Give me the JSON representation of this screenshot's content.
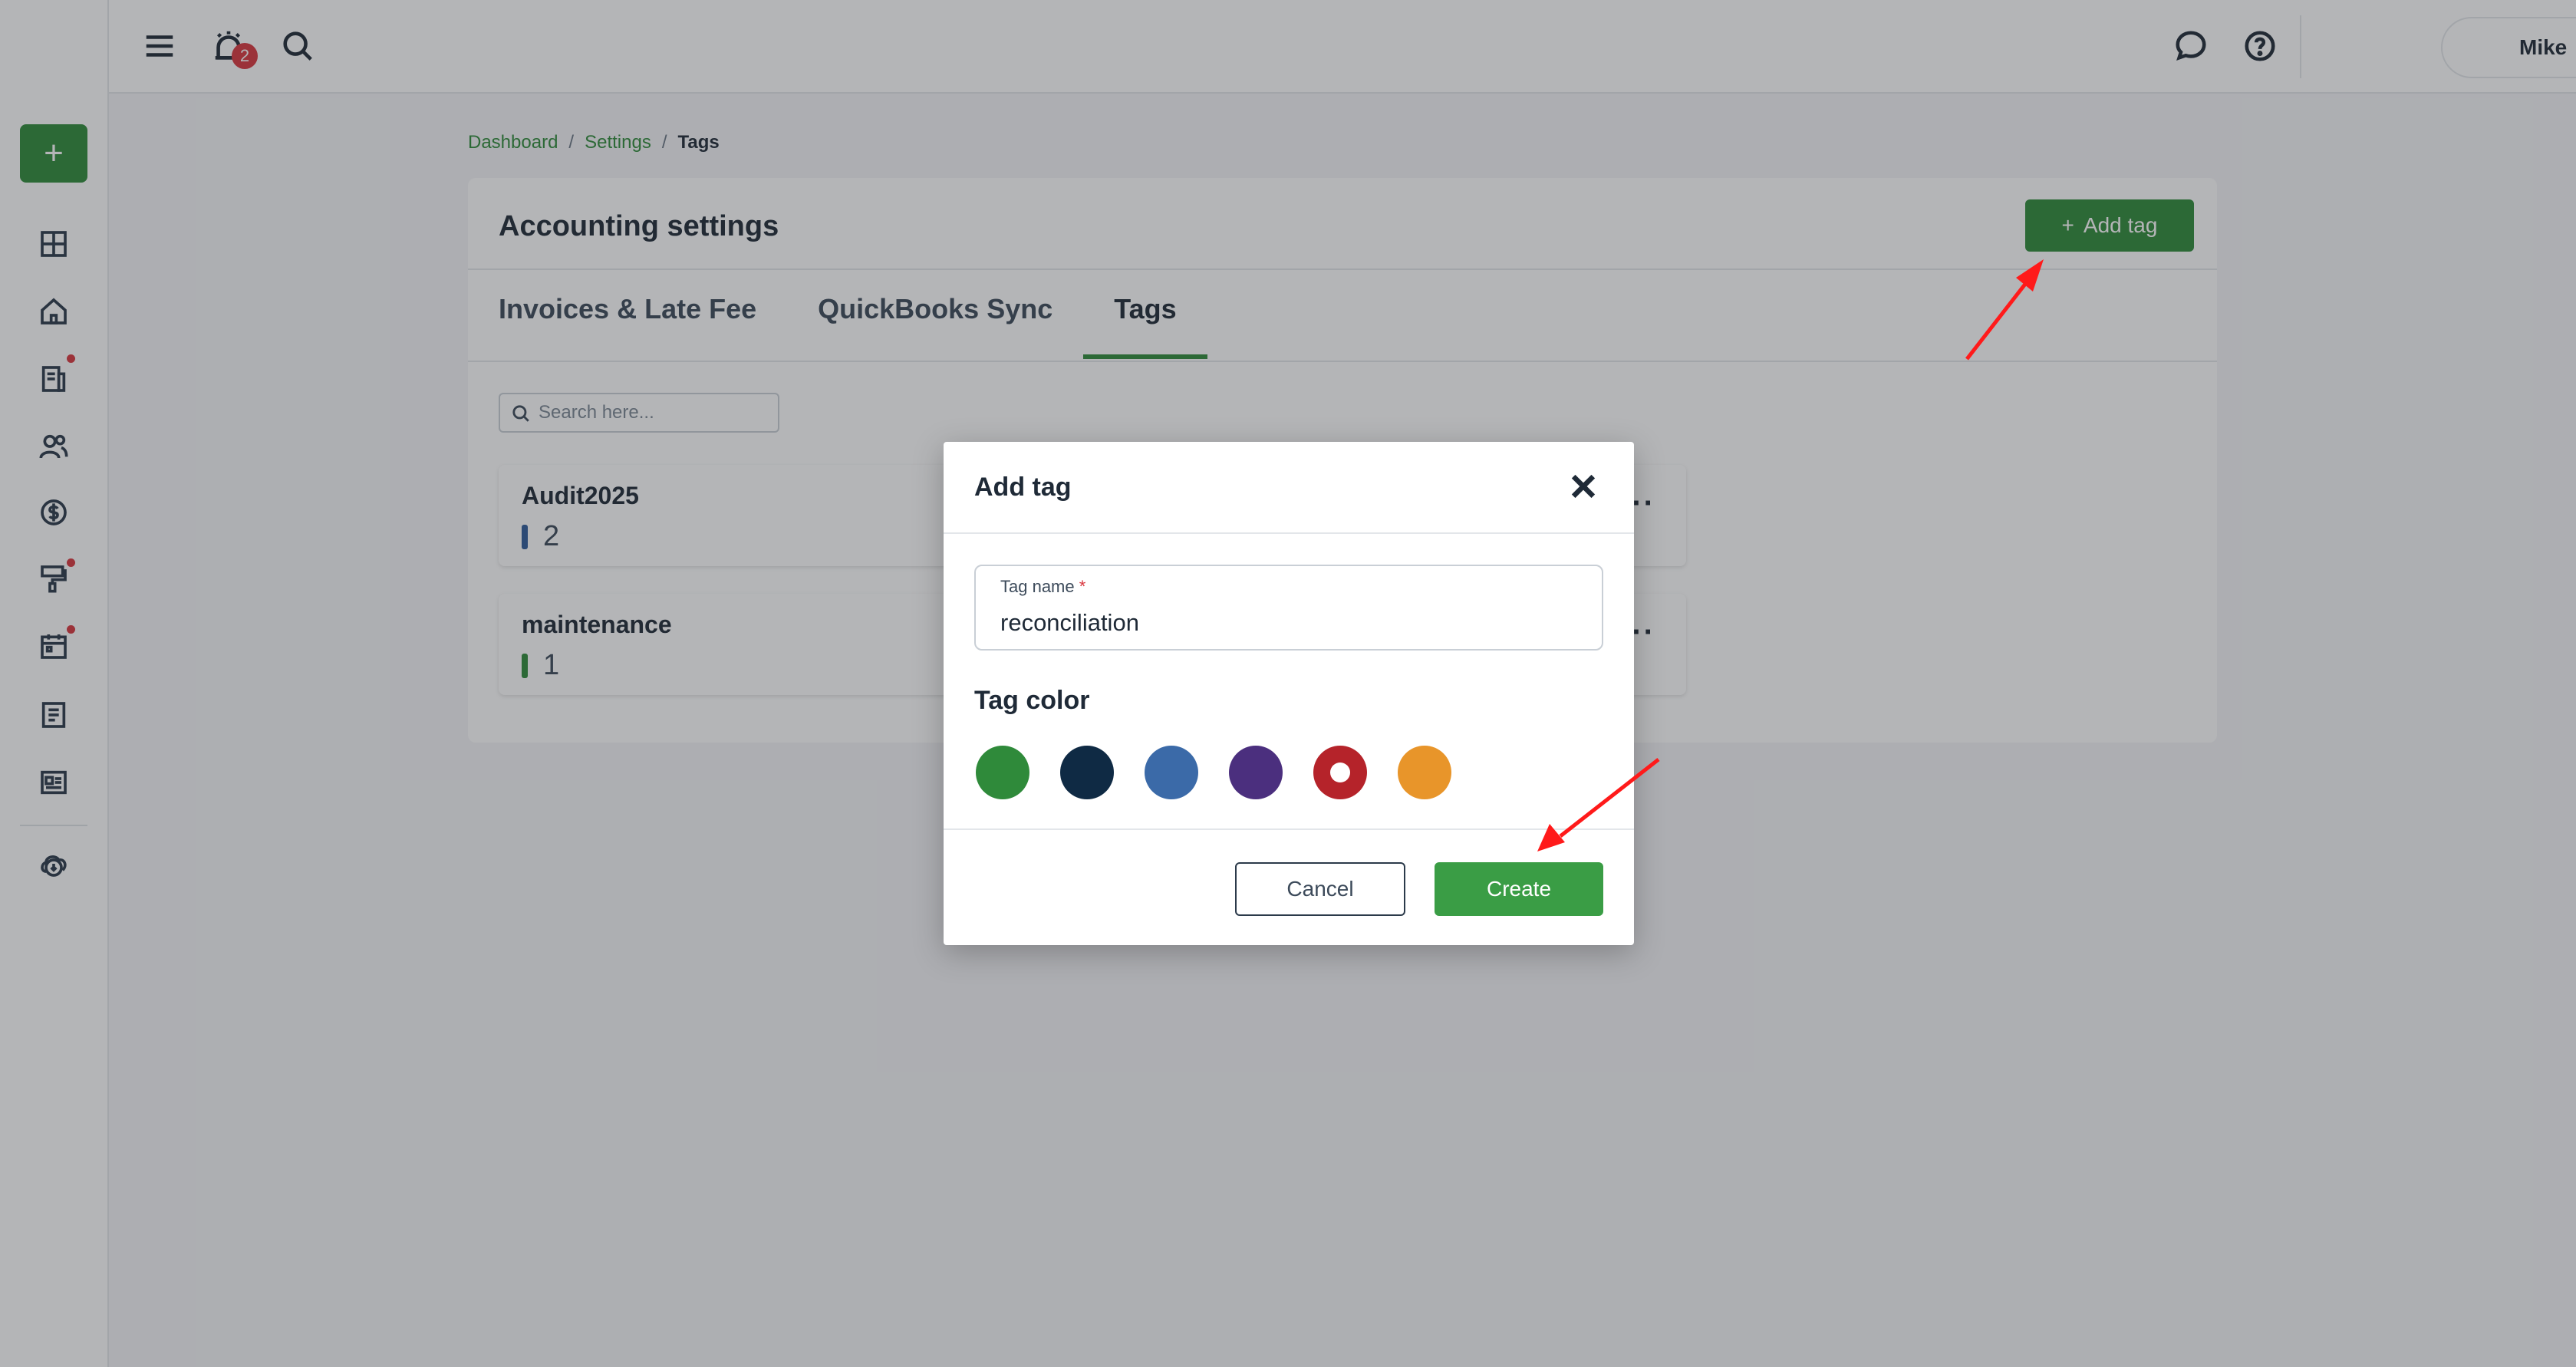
{
  "topbar": {
    "notification_count": "2",
    "user_name": "Mike"
  },
  "breadcrumb": {
    "items": [
      "Dashboard",
      "Settings",
      "Tags"
    ],
    "separator": "/"
  },
  "card": {
    "title": "Accounting settings",
    "add_tag_label": "Add tag",
    "tabs": [
      {
        "label": "Invoices & Late Fee",
        "active": false
      },
      {
        "label": "QuickBooks Sync",
        "active": false
      },
      {
        "label": "Tags",
        "active": true
      }
    ],
    "search_placeholder": "Search here...",
    "tags": [
      {
        "name": "Audit2025",
        "count": "2",
        "color": "#2e5b9a"
      },
      {
        "name": "maintenance",
        "count": "1",
        "color": "#2f8a3a"
      }
    ]
  },
  "modal": {
    "title": "Add tag",
    "tag_name_label": "Tag name",
    "required_mark": "*",
    "tag_name_value": "reconciliation",
    "tag_color_heading": "Tag color",
    "colors": [
      "#2f8a3a",
      "#0f2a44",
      "#3b6aa8",
      "#4b2f7e",
      "#b5232a",
      "#e8952a"
    ],
    "selected_color_index": 4,
    "cancel_label": "Cancel",
    "create_label": "Create"
  },
  "theme": {
    "accent": "#2f8a3a",
    "danger": "#d9363e"
  }
}
